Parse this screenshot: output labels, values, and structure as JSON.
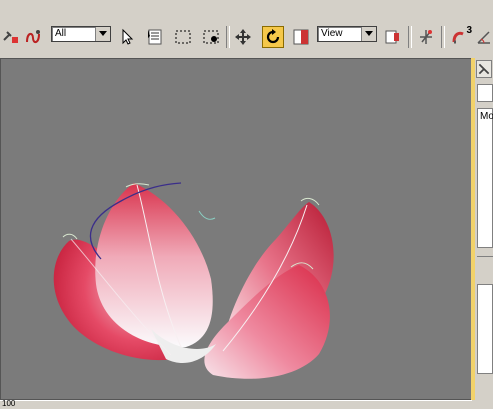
{
  "toolbar": {
    "selection_filter": "All",
    "reference_coord": "View",
    "superscript": "3"
  },
  "command_panel": {
    "tab_label": "Mo"
  },
  "statusbar": {
    "value": "100"
  },
  "colors": {
    "viewport_bg": "#7b7b7b",
    "active_border": "#f2d26a",
    "ui_gray": "#d4d0c8",
    "petal_red": "#e0344f"
  }
}
